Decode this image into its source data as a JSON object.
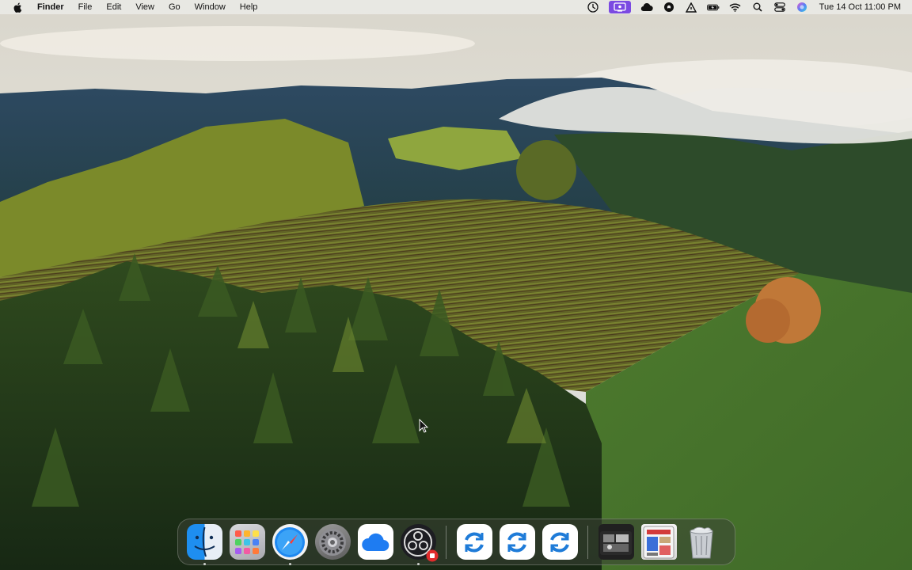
{
  "menubar": {
    "apple_icon": "apple-logo-icon",
    "app_name": "Finder",
    "menus": [
      "File",
      "Edit",
      "View",
      "Go",
      "Window",
      "Help"
    ],
    "status_icons": [
      "screen-time-icon",
      "screen-recording-icon",
      "creative-cloud-icon",
      "podcast-icon",
      "drive-icon",
      "battery-icon",
      "wifi-icon",
      "search-icon",
      "control-center-icon",
      "siri-icon"
    ],
    "clock": "Tue 14 Oct  11:00 PM"
  },
  "dock": {
    "apps": [
      {
        "name": "finder",
        "icon": "finder-icon",
        "running": true
      },
      {
        "name": "launchpad",
        "icon": "launchpad-icon",
        "running": false
      },
      {
        "name": "safari",
        "icon": "safari-icon",
        "running": true
      },
      {
        "name": "system-settings",
        "icon": "gear-icon",
        "running": false
      },
      {
        "name": "icloud-drive",
        "icon": "cloud-icon",
        "running": false
      },
      {
        "name": "obs",
        "icon": "obs-icon",
        "running": true
      },
      {
        "name": "sync-app-1",
        "icon": "sync-icon",
        "running": false
      },
      {
        "name": "sync-app-2",
        "icon": "sync-icon",
        "running": false
      },
      {
        "name": "sync-app-3",
        "icon": "sync-icon",
        "running": false
      },
      {
        "name": "downloads-stack",
        "icon": "folder-stack-icon",
        "running": false
      },
      {
        "name": "preview-stack",
        "icon": "preview-stack-icon",
        "running": false
      },
      {
        "name": "trash",
        "icon": "trash-icon",
        "running": false
      }
    ]
  },
  "colors": {
    "menubar_bg": "#ecece8",
    "accent_purple": "#7b4ae2",
    "obs_badge": "#e02b2b"
  }
}
